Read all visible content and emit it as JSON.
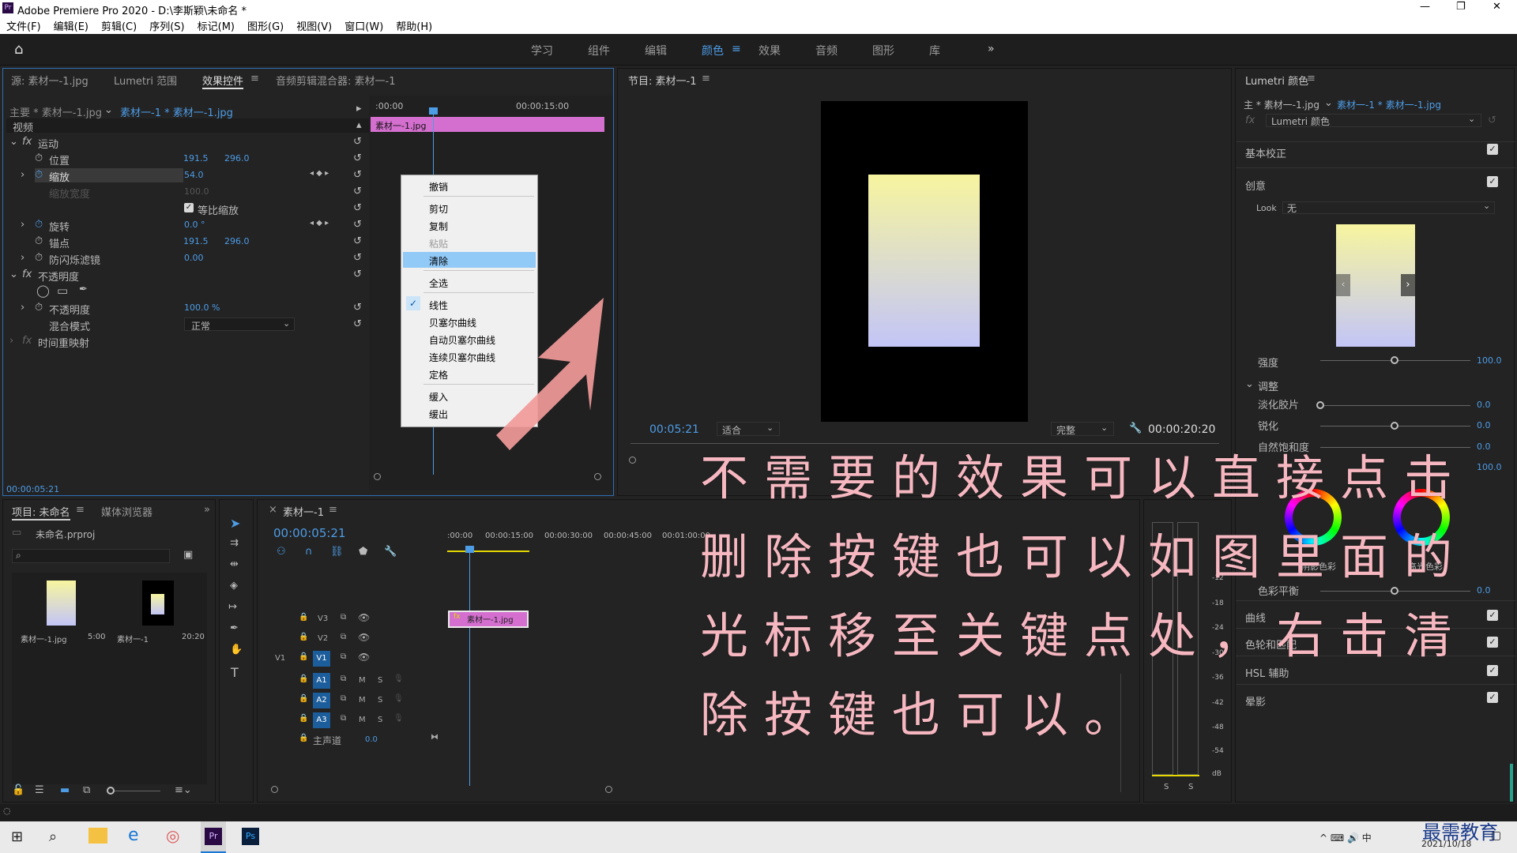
{
  "title": "Adobe Premiere Pro 2020 - D:\\李斯颖\\未命名 *",
  "menu": [
    "文件(F)",
    "编辑(E)",
    "剪辑(C)",
    "序列(S)",
    "标记(M)",
    "图形(G)",
    "视图(V)",
    "窗口(W)",
    "帮助(H)"
  ],
  "workspaces": [
    "学习",
    "组件",
    "编辑",
    "颜色",
    "效果",
    "音频",
    "图形",
    "库"
  ],
  "active_workspace": "颜色",
  "source_panel": {
    "tabs": [
      "源: 素材一-1.jpg",
      "Lumetri 范围",
      "效果控件",
      "音频剪辑混合器: 素材一-1"
    ],
    "master": "主要 * 素材一-1.jpg",
    "clip": "素材一-1 * 素材一-1.jpg",
    "time_start": ":00:00",
    "time_mid": "00:00:15:00",
    "clip_label": "素材一-1.jpg",
    "video_label": "视频",
    "motion": "运动",
    "position_label": "位置",
    "position_x": "191.5",
    "position_y": "296.0",
    "scale_label": "缩放",
    "scale_value": "54.0",
    "scale_width_label": "缩放宽度",
    "scale_width_value": "100.0",
    "uniform_scale": "等比缩放",
    "rotation_label": "旋转",
    "rotation_value": "0.0 °",
    "anchor_label": "锚点",
    "anchor_x": "191.5",
    "anchor_y": "296.0",
    "antiflicker_label": "防闪烁滤镜",
    "antiflicker_value": "0.00",
    "opacity_group": "不透明度",
    "opacity_label": "不透明度",
    "opacity_value": "100.0 %",
    "blend_label": "混合模式",
    "blend_value": "正常",
    "time_remap": "时间重映射",
    "timecode": "00:00:05:21"
  },
  "context_menu": {
    "items": [
      "撤销",
      "剪切",
      "复制",
      "粘贴",
      "清除",
      "全选",
      "线性",
      "贝塞尔曲线",
      "自动贝塞尔曲线",
      "连续贝塞尔曲线",
      "定格",
      "缓入",
      "缓出"
    ],
    "highlighted": "清除",
    "checked": "线性"
  },
  "program": {
    "tab": "节目: 素材一-1",
    "timecode": "00:05:21",
    "fit": "适合",
    "quality": "完整",
    "duration": "00:00:20:20"
  },
  "lumetri": {
    "tab": "Lumetri 颜色",
    "master": "主 * 素材一-1.jpg",
    "clip": "素材一-1 * 素材一-1.jpg",
    "effect": "Lumetri 颜色",
    "basic": "基本校正",
    "creative": "创意",
    "look_label": "Look",
    "look_value": "无",
    "intensity_label": "强度",
    "intensity_value": "100.0",
    "adjust": "调整",
    "fade_label": "淡化胶片",
    "fade_value": "0.0",
    "sharpen_label": "锐化",
    "sharpen_value": "0.0",
    "vibrance_label": "自然饱和度",
    "vibrance_value": "0.0",
    "saturation_value": "100.0",
    "shadow_tint": "阴影色彩",
    "highlight_tint": "高光色彩",
    "balance_label": "色彩平衡",
    "balance_value": "0.0",
    "curves": "曲线",
    "color_wheels": "色轮和匹配",
    "hsl": "HSL 辅助",
    "vignette": "晕影"
  },
  "project": {
    "tabs": [
      "项目: 未命名",
      "媒体浏览器"
    ],
    "file": "未命名.prproj",
    "items": [
      {
        "name": "素材一-1.jpg",
        "duration": "5:00"
      },
      {
        "name": "素材一-1",
        "duration": "20:20"
      }
    ]
  },
  "timeline": {
    "tab": "素材一-1",
    "timecode": "00:00:05:21",
    "ruler": [
      ":00:00",
      "00:00:15:00",
      "00:00:30:00",
      "00:00:45:00",
      "00:01:00:00"
    ],
    "clip": "素材一-1.jpg",
    "video_tracks": [
      "V3",
      "V2",
      "V1"
    ],
    "audio_tracks": [
      "A1",
      "A2",
      "A3"
    ],
    "master_label": "主声道",
    "master_value": "0.0",
    "src_patch": "V1"
  },
  "meter_labels": [
    "-12",
    "-18",
    "-24",
    "-30",
    "-36",
    "-42",
    "-48",
    "-54",
    "dB"
  ],
  "overlay_lines": [
    "不需要的效果可以直接点击",
    "删除按键也可以如图里面的",
    "光标移至关键点处，右击清",
    "除按键也可以。"
  ],
  "taskbar": {
    "date": "2021/10/18",
    "watermark": "最需教育"
  },
  "colors": {
    "accent": "#4d9ce6",
    "clip_pink": "#d46fcf",
    "overlay_text": "#f6b7c0",
    "arrow": "#f29a9a"
  }
}
